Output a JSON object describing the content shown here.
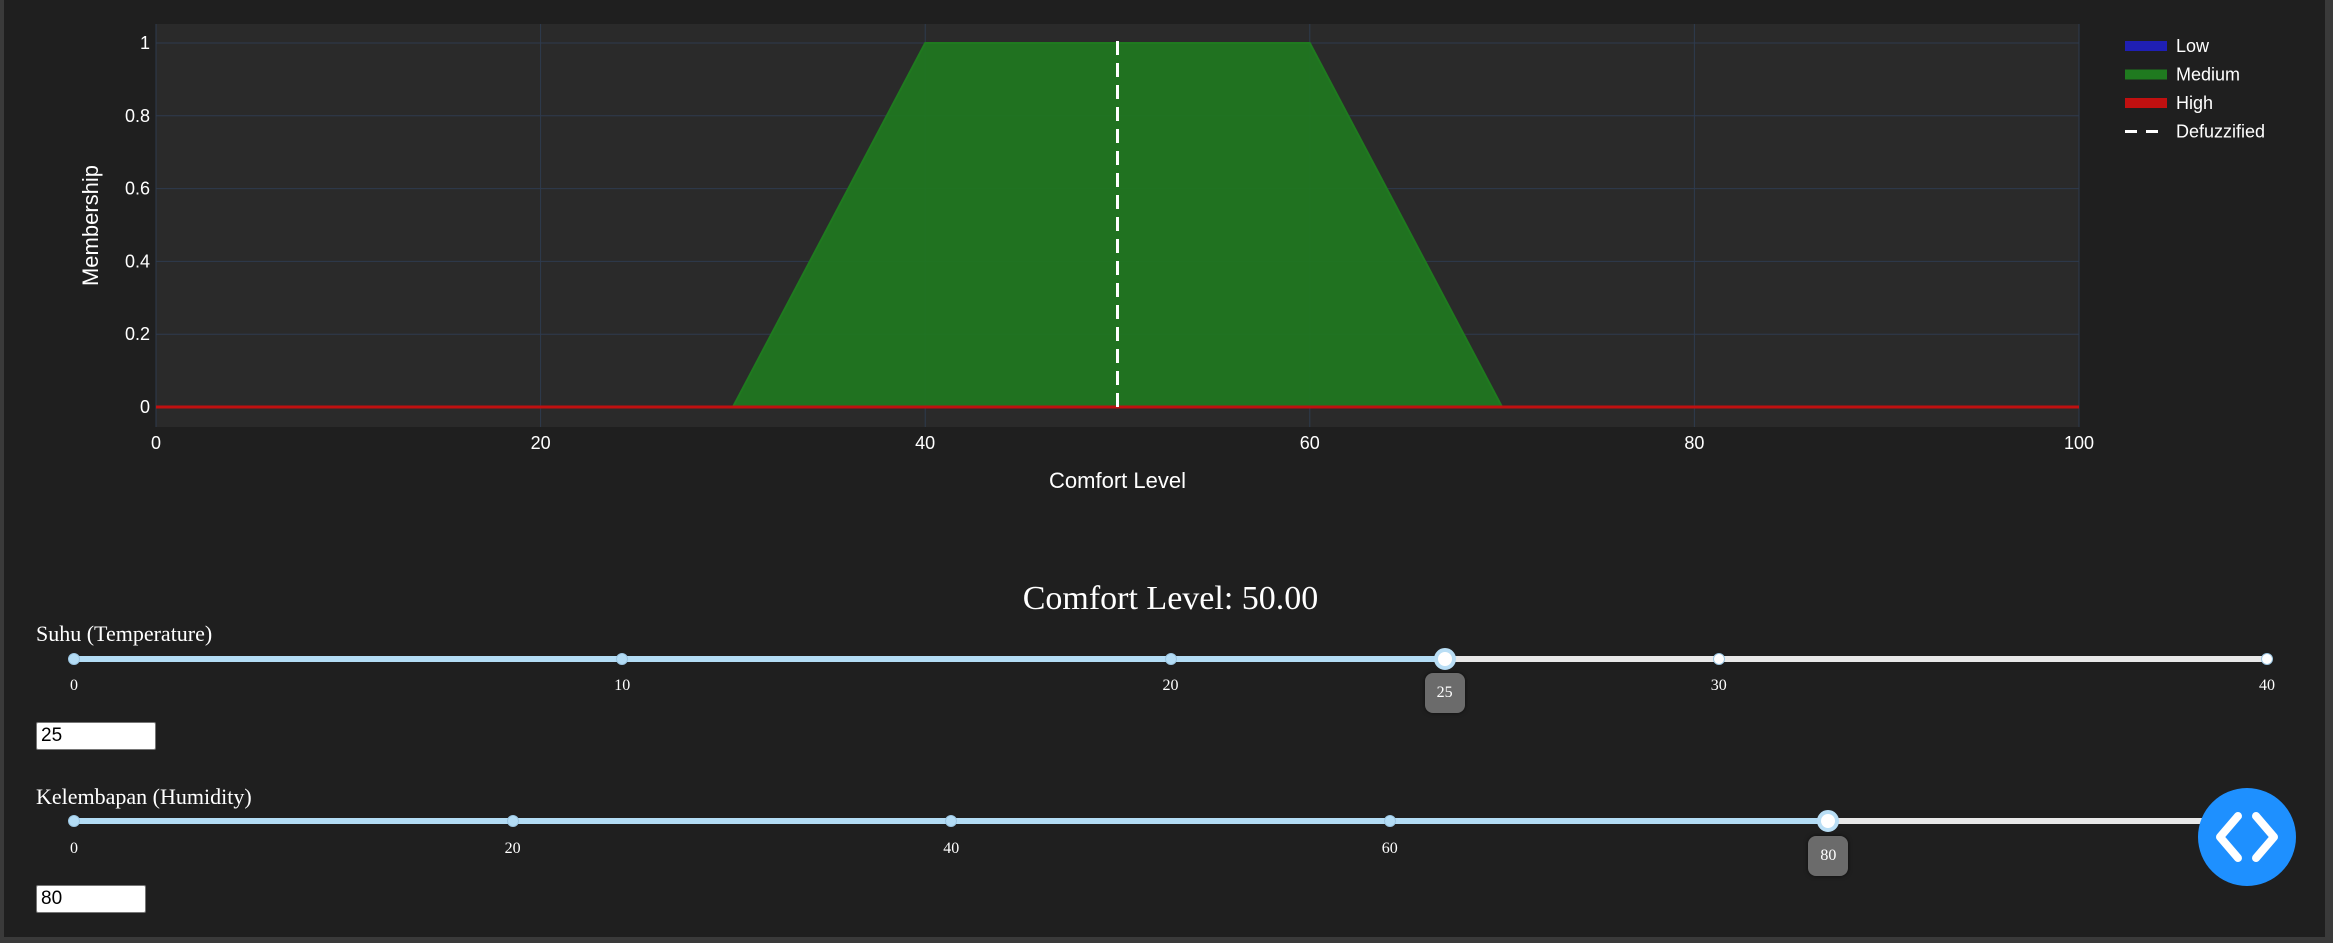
{
  "chart_data": {
    "type": "area",
    "xlabel": "Comfort Level",
    "ylabel": "Membership",
    "xlim": [
      0,
      100
    ],
    "ylim": [
      0,
      1
    ],
    "x_ticks": [
      "0",
      "20",
      "40",
      "60",
      "80",
      "100"
    ],
    "y_ticks": [
      "0",
      "0.2",
      "0.4",
      "0.6",
      "0.8",
      "1"
    ],
    "grid": true,
    "legend_position": "right",
    "series": [
      {
        "name": "Low",
        "color": "#1f1fb4",
        "points": [
          [
            0,
            0
          ],
          [
            100,
            0
          ]
        ]
      },
      {
        "name": "Medium",
        "color": "#1f7a1f",
        "points": [
          [
            0,
            0
          ],
          [
            30,
            0
          ],
          [
            40,
            1
          ],
          [
            60,
            1
          ],
          [
            70,
            0
          ],
          [
            100,
            0
          ]
        ]
      },
      {
        "name": "High",
        "color": "#c01010",
        "points": [
          [
            0,
            0
          ],
          [
            100,
            0
          ]
        ]
      },
      {
        "name": "Defuzzified",
        "color": "#ffffff",
        "style": "dashed",
        "x": 50
      }
    ]
  },
  "result": {
    "comfort_text": "Comfort Level: 50.00"
  },
  "sliders": [
    {
      "label": "Suhu (Temperature)",
      "min": 0,
      "max": 40,
      "value": 25,
      "value_text": "25",
      "tick_values": [
        0,
        10,
        20,
        30,
        40
      ],
      "tick_labels": [
        "0",
        "10",
        "20",
        "30",
        "40"
      ],
      "input_value": "25"
    },
    {
      "label": "Kelembapan (Humidity)",
      "min": 0,
      "max": 100,
      "value": 80,
      "value_text": "80",
      "tick_values": [
        0,
        20,
        40,
        60,
        80
      ],
      "tick_labels": [
        "0",
        "20",
        "40",
        "60",
        "80"
      ],
      "input_value": "80"
    }
  ],
  "colors": {
    "active_track": "#b3dcf5",
    "inactive_track": "#e8e8e8",
    "plot_background": "#2a2a2a",
    "page_background": "#1f1f1f",
    "fab": "#1e90ff"
  },
  "icons": {
    "fab": "code-brackets-icon"
  }
}
